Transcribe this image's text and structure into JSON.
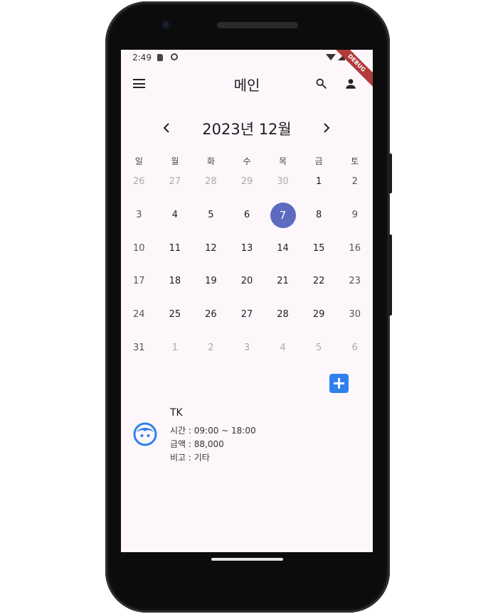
{
  "status": {
    "time": "2:49"
  },
  "debug_label": "DEBUG",
  "appbar": {
    "title": "메인"
  },
  "calendar": {
    "month_title": "2023년 12월",
    "weekdays": [
      "일",
      "월",
      "화",
      "수",
      "목",
      "금",
      "토"
    ],
    "weeks": [
      [
        "26",
        "27",
        "28",
        "29",
        "30",
        "1",
        "2"
      ],
      [
        "3",
        "4",
        "5",
        "6",
        "7",
        "8",
        "9"
      ],
      [
        "10",
        "11",
        "12",
        "13",
        "14",
        "15",
        "16"
      ],
      [
        "17",
        "18",
        "19",
        "20",
        "21",
        "22",
        "23"
      ],
      [
        "24",
        "25",
        "26",
        "27",
        "28",
        "29",
        "30"
      ],
      [
        "31",
        "1",
        "2",
        "3",
        "4",
        "5",
        "6"
      ]
    ],
    "selected_day": "7",
    "accent_color": "#5c6bc0"
  },
  "event": {
    "name": "TK",
    "time": "시간 : 09:00 ~ 18:00",
    "amount": "금액 : 88,000",
    "note": "비고 : 기타",
    "icon": "face-icon",
    "color": "#2f80ed"
  }
}
